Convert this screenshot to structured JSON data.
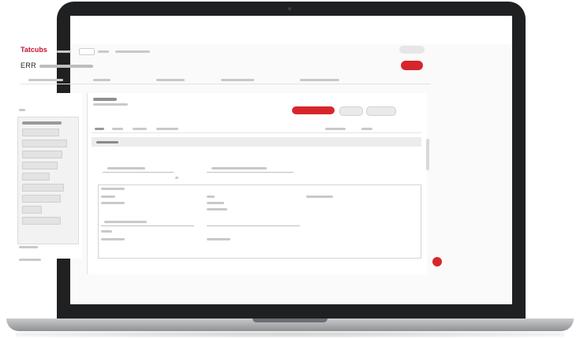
{
  "header": {
    "brand": "Tatcubs",
    "page_title": "ERR"
  },
  "colors": {
    "accent": "#d7262b",
    "laptop_body": "#1f2022",
    "sidebar_bg": "#f2f2f2"
  },
  "icons": {
    "fab": "help-icon"
  }
}
